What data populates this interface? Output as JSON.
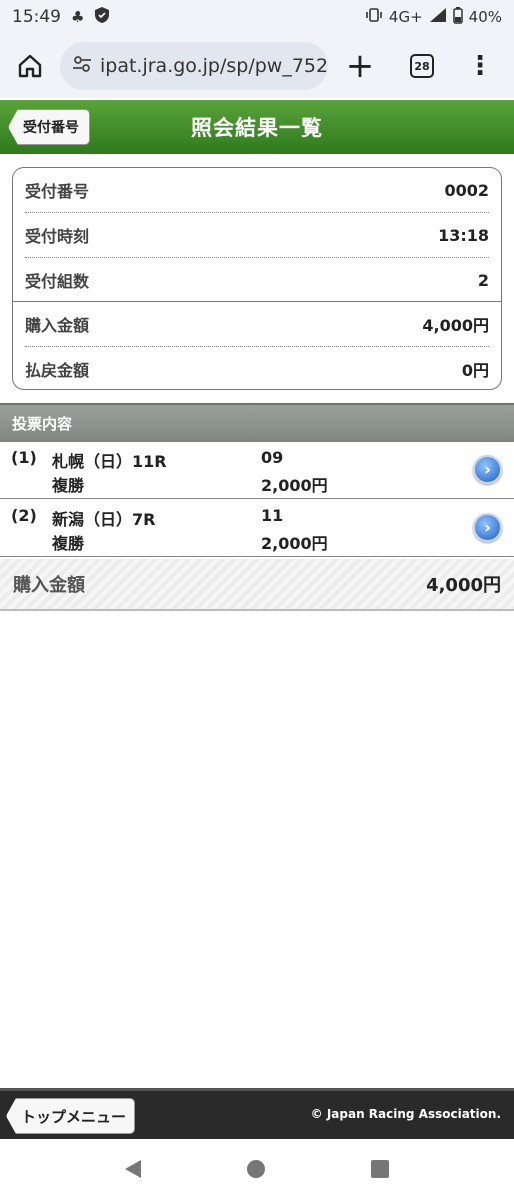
{
  "status_bar": {
    "time": "15:49",
    "network": "4G+",
    "battery": "40%"
  },
  "browser": {
    "url": "ipat.jra.go.jp/sp/pw_752_",
    "tab_count": "28",
    "plus_label": "+",
    "menu_label": "⋮"
  },
  "header": {
    "back_label": "受付番号",
    "title": "照会結果一覧",
    "color": "#3f8e2a"
  },
  "summary": {
    "rows": [
      {
        "label": "受付番号",
        "value": "0002"
      },
      {
        "label": "受付時刻",
        "value": "13:18"
      },
      {
        "label": "受付組数",
        "value": "2"
      },
      {
        "label": "購入金額",
        "value": "4,000円"
      },
      {
        "label": "払戻金額",
        "value": "0円"
      }
    ]
  },
  "votes": {
    "section_title": "投票内容",
    "items": [
      {
        "num": "(1)",
        "race": "札幌（日）11R",
        "type": "複勝",
        "horse": "09",
        "amount": "2,000円"
      },
      {
        "num": "(2)",
        "race": "新潟（日）7R",
        "type": "複勝",
        "horse": "11",
        "amount": "2,000円"
      }
    ]
  },
  "total": {
    "label": "購入金額",
    "value": "4,000円"
  },
  "footer": {
    "top_menu_label": "トップメニュー",
    "copyright": "© Japan Racing Association."
  },
  "icons": {
    "arrow": "chevron-right-icon",
    "home": "home-icon",
    "tune": "site-settings-icon"
  }
}
